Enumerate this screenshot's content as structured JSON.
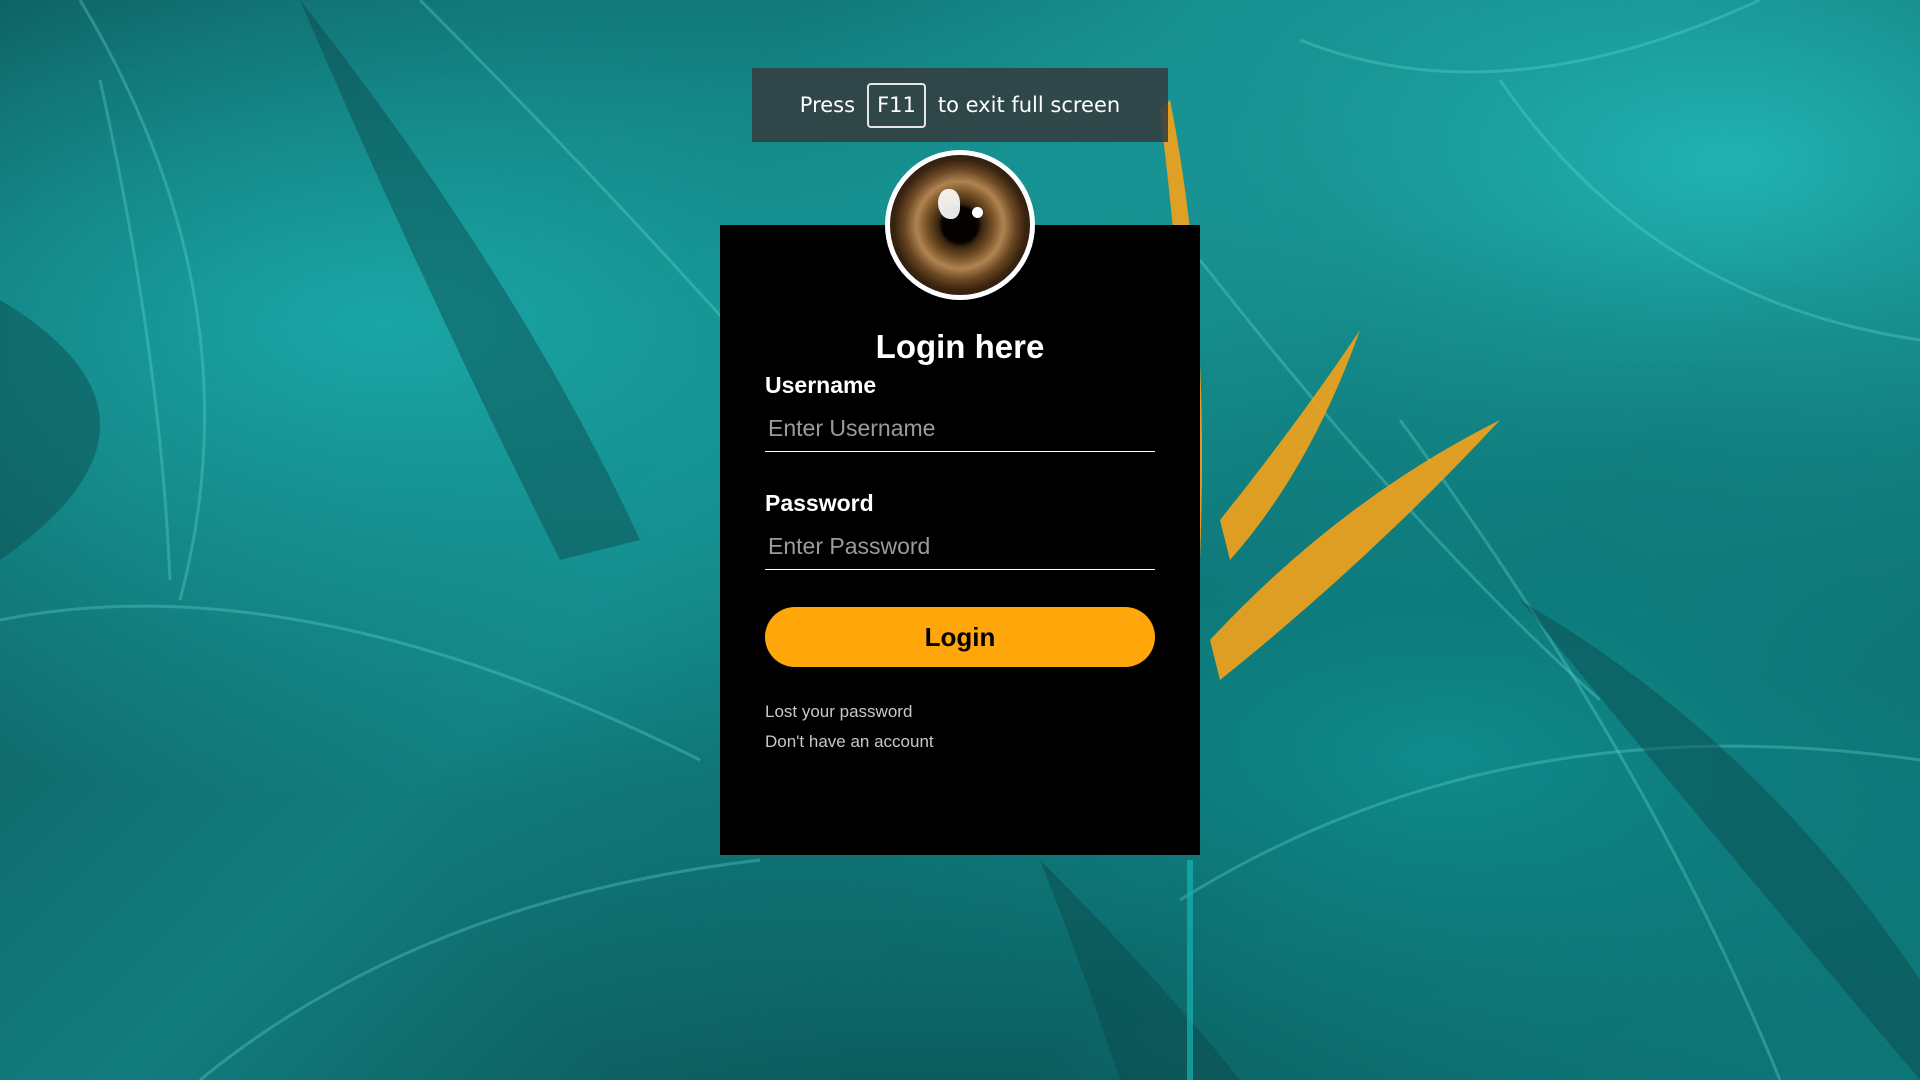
{
  "fullscreen_notice": {
    "prefix": "Press",
    "key": "F11",
    "suffix": "to exit full screen"
  },
  "login": {
    "title": "Login here",
    "username_label": "Username",
    "username_placeholder": "Enter Username",
    "password_label": "Password",
    "password_placeholder": "Enter Password",
    "submit_label": "Login",
    "forgot_link": "Lost your password",
    "signup_link": "Don't have an account"
  },
  "colors": {
    "accent": "#fea60a",
    "panel": "#000000",
    "background": "#127c7d"
  },
  "icons": {
    "avatar": "eye-avatar-icon"
  }
}
